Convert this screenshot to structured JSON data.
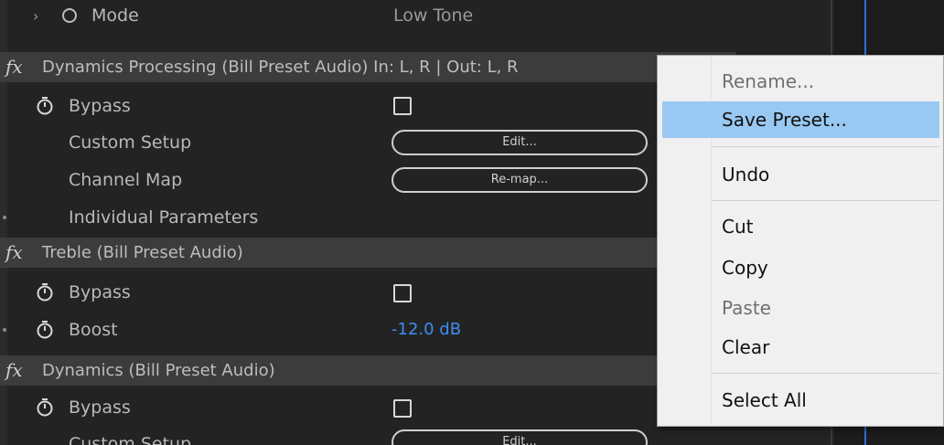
{
  "mode_row": {
    "label": "Mode",
    "value": "Low Tone"
  },
  "effects": [
    {
      "fx": "fx",
      "title": "Dynamics Processing (Bill Preset Audio) In: L, R | Out: L, R",
      "bypass_label": "Bypass",
      "custom_setup_label": "Custom Setup",
      "custom_setup_button": "Edit...",
      "channel_map_label": "Channel Map",
      "channel_map_button": "Re-map...",
      "individual_params_label": "Individual Parameters"
    },
    {
      "fx": "fx",
      "title": "Treble (Bill Preset Audio)",
      "bypass_label": "Bypass",
      "boost_label": "Boost",
      "boost_value": "-12.0 dB"
    },
    {
      "fx": "fx",
      "title": "Dynamics (Bill Preset Audio)",
      "bypass_label": "Bypass",
      "custom_setup_label": "Custom Setup",
      "custom_setup_button": "Edit..."
    }
  ],
  "context_menu": {
    "items": [
      {
        "label": "Rename...",
        "enabled": false,
        "highlighted": false
      },
      {
        "label": "Save Preset...",
        "enabled": true,
        "highlighted": true
      },
      {
        "label": "Undo",
        "enabled": true,
        "highlighted": false
      },
      {
        "label": "Cut",
        "enabled": true,
        "highlighted": false
      },
      {
        "label": "Copy",
        "enabled": true,
        "highlighted": false
      },
      {
        "label": "Paste",
        "enabled": false,
        "highlighted": false
      },
      {
        "label": "Clear",
        "enabled": true,
        "highlighted": false
      },
      {
        "label": "Select All",
        "enabled": true,
        "highlighted": false
      }
    ]
  },
  "colors": {
    "panel_bg": "#232323",
    "header_bg": "#3c3c3c",
    "value_blue": "#3f8ef0",
    "menu_highlight": "#99c9f2",
    "playhead": "#2f6fd6"
  },
  "icons": {
    "stopwatch": "stopwatch-icon",
    "fx": "fx-icon",
    "chevron": "chevron-right-icon"
  }
}
